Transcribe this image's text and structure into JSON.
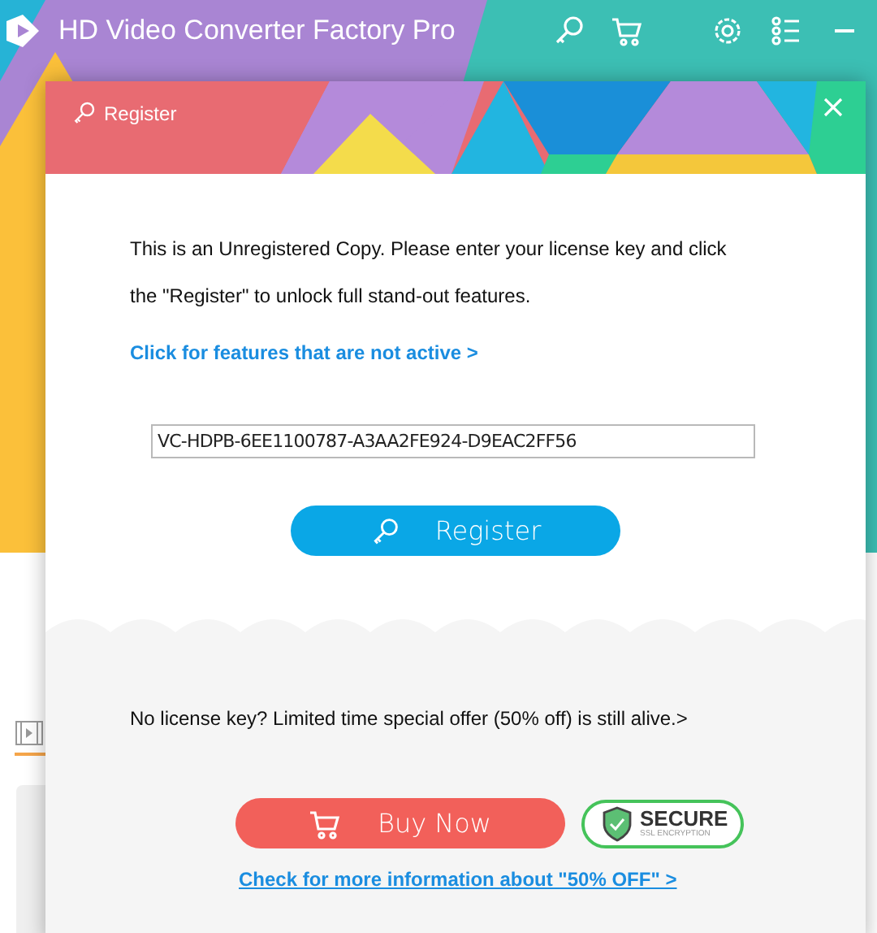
{
  "app": {
    "title": "HD Video Converter Factory Pro"
  },
  "dialog": {
    "title": "Register",
    "message": "This is an Unregistered Copy. Please enter your license key and click the \"Register\" to unlock full stand-out features.",
    "features_link": "Click for features that are not active >",
    "license_key": {
      "value": "VC-HDPB-6EE1100787-A3AA2FE924-D9EAC2FF56"
    },
    "register_button": "Register",
    "offer_text": "No license key? Limited time special offer (50% off) is still alive.>",
    "buy_button": "Buy Now",
    "secure_badge": {
      "title": "SECURE",
      "subtitle": "SSL ENCRYPTION"
    },
    "more_info_link": "Check for more information about \"50% OFF\" >"
  }
}
